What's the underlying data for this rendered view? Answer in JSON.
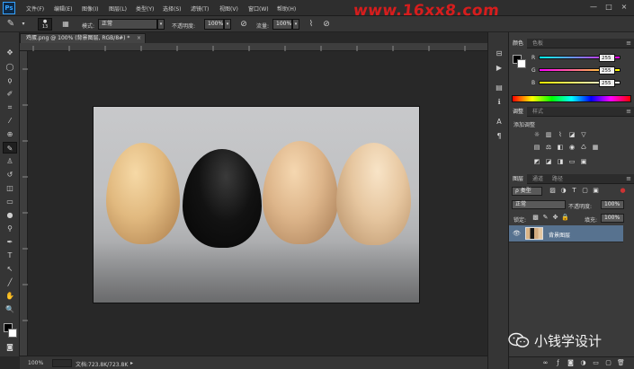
{
  "menubar": {
    "logo": "Ps",
    "items": [
      "文件(F)",
      "编辑(E)",
      "图像(I)",
      "图层(L)",
      "类型(Y)",
      "选择(S)",
      "滤镜(T)",
      "视图(V)",
      "窗口(W)",
      "帮助(H)"
    ],
    "window_controls": [
      "—",
      "□",
      "×"
    ],
    "watermark": "www.16xx8.com"
  },
  "options_bar": {
    "brush_size": "13",
    "mode_label": "模式:",
    "mode_value": "正常",
    "opacity_label": "不透明度:",
    "opacity_value": "100%",
    "flow_label": "流量:",
    "flow_value": "100%"
  },
  "document": {
    "tab_title": "鸡蛋.png @ 100% (背景图层, RGB/8#) *",
    "close_glyph": "×"
  },
  "status_bar": {
    "zoom": "100%",
    "doc_info": "文档:723.8K/723.8K",
    "arrow": "▸"
  },
  "color_panel": {
    "tabs": [
      "颜色",
      "色板"
    ],
    "channels": [
      {
        "label": "R",
        "value": "255",
        "color_from": "#00ffff",
        "color_to": "#ff00ff"
      },
      {
        "label": "G",
        "value": "255",
        "color_from": "#ff00ff",
        "color_to": "#ffff00"
      },
      {
        "label": "B",
        "value": "255",
        "color_from": "#ffff00",
        "color_to": "#ffffff"
      }
    ]
  },
  "adjustments_panel": {
    "tabs": [
      "调整",
      "样式"
    ],
    "title": "添加调整"
  },
  "layers_panel": {
    "tabs": [
      "图层",
      "通道",
      "路径"
    ],
    "kind_label": "ρ 类型",
    "blend_mode": "正常",
    "opacity_label": "不透明度:",
    "opacity_value": "100%",
    "lock_label": "锁定:",
    "fill_label": "填充:",
    "fill_value": "100%",
    "layers": [
      {
        "name": "背景图层"
      }
    ]
  },
  "overlay": {
    "wechat_text": "小钱学设计"
  },
  "colors": {
    "accent_blue": "#35a2ff",
    "selected_layer": "#57728f",
    "watermark_red": "#e01d1d"
  }
}
